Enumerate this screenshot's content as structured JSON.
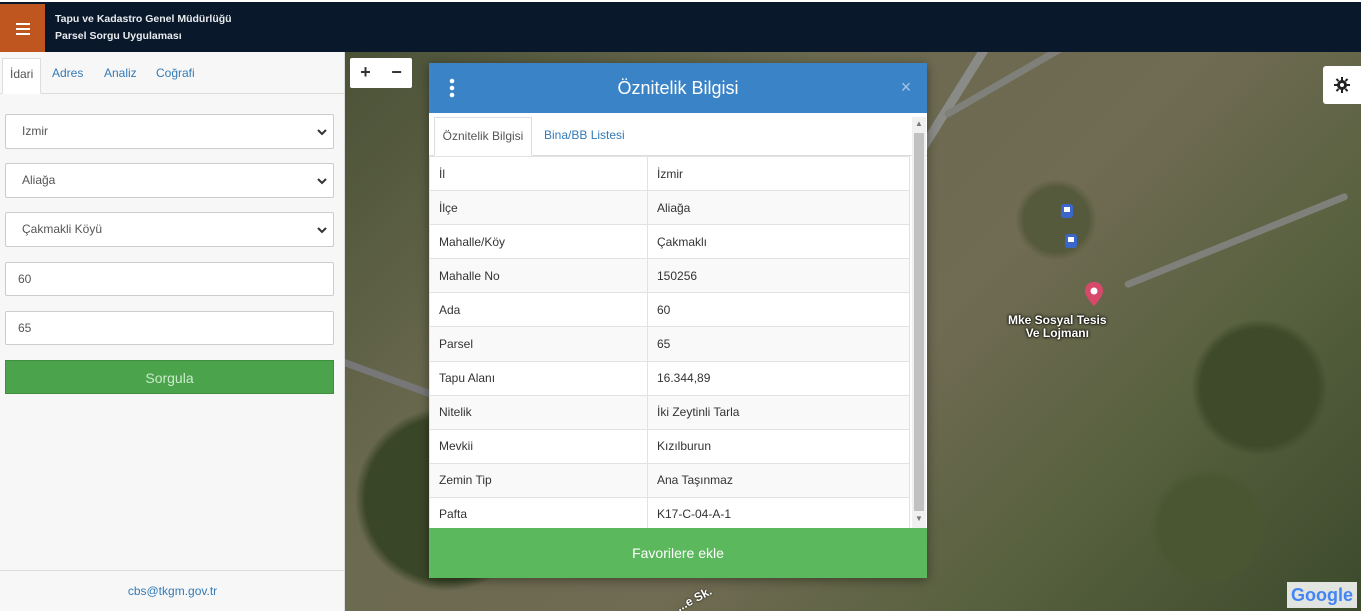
{
  "header": {
    "title_line1": "Tapu ve Kadastro Genel Müdürlüğü",
    "title_line2": "Parsel Sorgu Uygulaması"
  },
  "sidebar": {
    "tabs": [
      {
        "label": "İdari",
        "active": true
      },
      {
        "label": "Adres"
      },
      {
        "label": "Analiz"
      },
      {
        "label": "Coğrafi"
      }
    ],
    "province": "Izmir",
    "district": "Aliağa",
    "neighborhood": "Çakmakli Köyü",
    "ada": "60",
    "parsel": "65",
    "query_button": "Sorgula",
    "footer_email": "cbs@tkgm.gov.tr"
  },
  "map": {
    "zoom_in": "+",
    "zoom_out": "−",
    "poi_line1": "Mke Sosyal Tesis",
    "poi_line2": "Ve Lojmanı",
    "street_label": "...e Sk.",
    "attribution": "Google"
  },
  "popup": {
    "title": "Öznitelik Bilgisi",
    "close": "×",
    "tabs": [
      "Öznitelik Bilgisi",
      "Bina/BB Listesi"
    ],
    "rows": [
      {
        "key": "İl",
        "value": "İzmir"
      },
      {
        "key": "İlçe",
        "value": "Aliağa"
      },
      {
        "key": "Mahalle/Köy",
        "value": "Çakmaklı"
      },
      {
        "key": "Mahalle No",
        "value": "150256"
      },
      {
        "key": "Ada",
        "value": "60"
      },
      {
        "key": "Parsel",
        "value": "65"
      },
      {
        "key": "Tapu Alanı",
        "value": "16.344,89"
      },
      {
        "key": "Nitelik",
        "value": "İki Zeytinli Tarla"
      },
      {
        "key": "Mevkii",
        "value": "Kızılburun"
      },
      {
        "key": "Zemin Tip",
        "value": "Ana Taşınmaz"
      },
      {
        "key": "Pafta",
        "value": "K17-C-04-A-1"
      }
    ],
    "favorite_button": "Favorilere ekle"
  },
  "colors": {
    "header_bg": "#09182a",
    "menu_bg": "#c0561f",
    "popup_header": "#3a83c6",
    "success": "#5cb85c",
    "link": "#337ab7"
  },
  "icons": [
    "menu-icon",
    "gear-icon",
    "kebab-menu-icon",
    "close-icon",
    "chevron-down-icon",
    "map-pin-icon",
    "bus-stop-icon"
  ]
}
